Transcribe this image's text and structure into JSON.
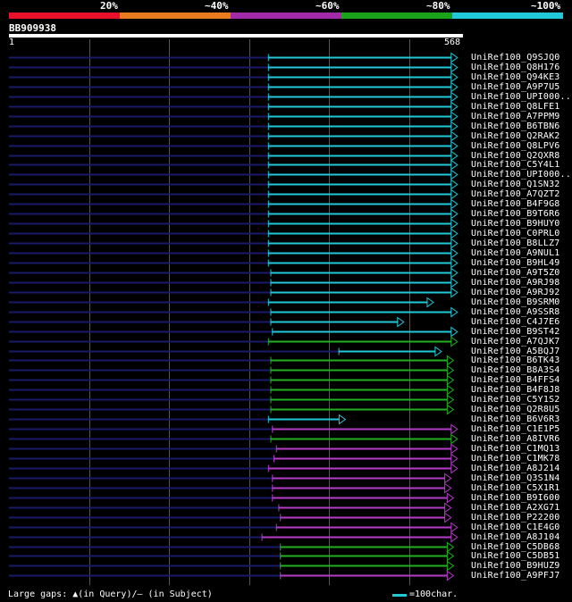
{
  "scale": {
    "labels": [
      "20%",
      "~40%",
      "~60%",
      "~80%",
      "~100%"
    ],
    "colors": [
      "#e8102a",
      "#e87a20",
      "#a12aa8",
      "#1aa21a",
      "#20c8d8"
    ]
  },
  "query": {
    "id": "BB909938",
    "start": "1",
    "end": "568",
    "length": 568
  },
  "colors": {
    "cyan": "#20c8d8",
    "green": "#22b022",
    "magenta": "#b43cc8",
    "navy": "#1a1a6a",
    "grid": "#555555"
  },
  "hits": [
    {
      "label": "UniRef100_Q9SJQ0",
      "start": 325,
      "end": 560,
      "color": "cyan"
    },
    {
      "label": "UniRef100_Q8H176",
      "start": 325,
      "end": 560,
      "color": "cyan"
    },
    {
      "label": "UniRef100_Q94KE3",
      "start": 325,
      "end": 560,
      "color": "cyan"
    },
    {
      "label": "UniRef100_A9P7U5",
      "start": 325,
      "end": 560,
      "color": "cyan"
    },
    {
      "label": "UniRef100_UPI000..",
      "start": 325,
      "end": 560,
      "color": "cyan"
    },
    {
      "label": "UniRef100_Q8LFE1",
      "start": 325,
      "end": 560,
      "color": "cyan"
    },
    {
      "label": "UniRef100_A7PPM9",
      "start": 325,
      "end": 560,
      "color": "cyan"
    },
    {
      "label": "UniRef100_B6TBN6",
      "start": 325,
      "end": 560,
      "color": "cyan"
    },
    {
      "label": "UniRef100_Q2RAK2",
      "start": 325,
      "end": 560,
      "color": "cyan"
    },
    {
      "label": "UniRef100_Q8LPV6",
      "start": 325,
      "end": 560,
      "color": "cyan"
    },
    {
      "label": "UniRef100_Q2QXR8",
      "start": 325,
      "end": 560,
      "color": "cyan"
    },
    {
      "label": "UniRef100_C5Y4L1",
      "start": 325,
      "end": 560,
      "color": "cyan"
    },
    {
      "label": "UniRef100_UPI000..",
      "start": 325,
      "end": 560,
      "color": "cyan"
    },
    {
      "label": "UniRef100_Q1SN32",
      "start": 325,
      "end": 560,
      "color": "cyan"
    },
    {
      "label": "UniRef100_A7QZT2",
      "start": 325,
      "end": 560,
      "color": "cyan"
    },
    {
      "label": "UniRef100_B4F9G8",
      "start": 325,
      "end": 560,
      "color": "cyan"
    },
    {
      "label": "UniRef100_B9T6R6",
      "start": 325,
      "end": 560,
      "color": "cyan"
    },
    {
      "label": "UniRef100_B9HUY0",
      "start": 325,
      "end": 560,
      "color": "cyan"
    },
    {
      "label": "UniRef100_C0PRL0",
      "start": 325,
      "end": 560,
      "color": "cyan"
    },
    {
      "label": "UniRef100_B8LLZ7",
      "start": 325,
      "end": 560,
      "color": "cyan"
    },
    {
      "label": "UniRef100_A9NUL1",
      "start": 325,
      "end": 560,
      "color": "cyan"
    },
    {
      "label": "UniRef100_B9HL49",
      "start": 325,
      "end": 560,
      "color": "cyan"
    },
    {
      "label": "UniRef100_A9T5Z0",
      "start": 328,
      "end": 560,
      "color": "cyan"
    },
    {
      "label": "UniRef100_A9RJ98",
      "start": 328,
      "end": 560,
      "color": "cyan"
    },
    {
      "label": "UniRef100_A9RJ92",
      "start": 328,
      "end": 560,
      "color": "cyan"
    },
    {
      "label": "UniRef100_B9SRM0",
      "start": 325,
      "end": 530,
      "color": "cyan"
    },
    {
      "label": "UniRef100_A9SSR8",
      "start": 328,
      "end": 560,
      "color": "cyan"
    },
    {
      "label": "UniRef100_C4J7E6",
      "start": 328,
      "end": 493,
      "color": "cyan"
    },
    {
      "label": "UniRef100_B9ST42",
      "start": 330,
      "end": 560,
      "color": "cyan"
    },
    {
      "label": "UniRef100_A7QJK7",
      "start": 325,
      "end": 560,
      "color": "green"
    },
    {
      "label": "UniRef100_A5BQJ7",
      "start": 413,
      "end": 540,
      "color": "cyan"
    },
    {
      "label": "UniRef100_B6TK43",
      "start": 328,
      "end": 555,
      "color": "green"
    },
    {
      "label": "UniRef100_B8A3S4",
      "start": 328,
      "end": 555,
      "color": "green"
    },
    {
      "label": "UniRef100_B4FFS4",
      "start": 328,
      "end": 555,
      "color": "green"
    },
    {
      "label": "UniRef100_B4F8J8",
      "start": 328,
      "end": 555,
      "color": "green"
    },
    {
      "label": "UniRef100_C5Y1S2",
      "start": 328,
      "end": 555,
      "color": "green"
    },
    {
      "label": "UniRef100_Q2R8U5",
      "start": 328,
      "end": 555,
      "color": "green"
    },
    {
      "label": "UniRef100_B6V6R3",
      "start": 325,
      "end": 420,
      "color": "cyan"
    },
    {
      "label": "UniRef100_C1E1P5",
      "start": 330,
      "end": 560,
      "color": "magenta"
    },
    {
      "label": "UniRef100_A8IVR6",
      "start": 328,
      "end": 560,
      "color": "green"
    },
    {
      "label": "UniRef100_C1MQ13",
      "start": 335,
      "end": 560,
      "color": "magenta"
    },
    {
      "label": "UniRef100_C1MK78",
      "start": 332,
      "end": 560,
      "color": "magenta"
    },
    {
      "label": "UniRef100_A8J214",
      "start": 325,
      "end": 560,
      "color": "magenta"
    },
    {
      "label": "UniRef100_Q3S1N4",
      "start": 330,
      "end": 552,
      "color": "magenta"
    },
    {
      "label": "UniRef100_C5X1R1",
      "start": 330,
      "end": 552,
      "color": "magenta"
    },
    {
      "label": "UniRef100_B9I600",
      "start": 330,
      "end": 555,
      "color": "magenta"
    },
    {
      "label": "UniRef100_A2XG71",
      "start": 338,
      "end": 552,
      "color": "magenta"
    },
    {
      "label": "UniRef100_P22200",
      "start": 340,
      "end": 552,
      "color": "magenta"
    },
    {
      "label": "UniRef100_C1E4G0",
      "start": 335,
      "end": 560,
      "color": "magenta"
    },
    {
      "label": "UniRef100_A8J104",
      "start": 317,
      "end": 560,
      "color": "magenta"
    },
    {
      "label": "UniRef100_C5DB68",
      "start": 340,
      "end": 555,
      "color": "green"
    },
    {
      "label": "UniRef100_C5DB51",
      "start": 340,
      "end": 555,
      "color": "green"
    },
    {
      "label": "UniRef100_B9HUZ9",
      "start": 340,
      "end": 555,
      "color": "green"
    },
    {
      "label": "UniRef100_A9PFJ7",
      "start": 340,
      "end": 555,
      "color": "magenta"
    }
  ],
  "footer": {
    "gaps_note": "Large gaps: ▲(in Query)/– (in Subject)",
    "legend_label": "=100char."
  }
}
